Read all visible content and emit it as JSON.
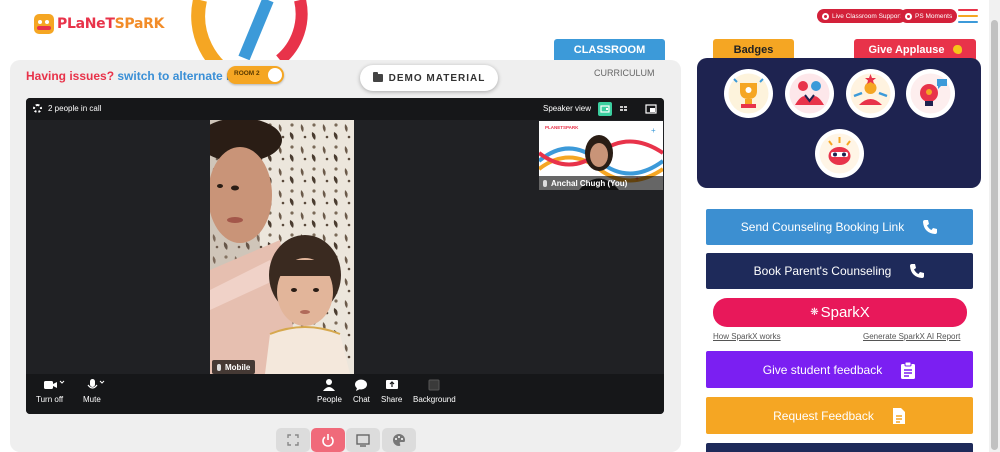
{
  "header": {
    "logo_text_a": "PLaNeT",
    "logo_text_b": "SPaRK",
    "live_support_label": "Live Classroom Support",
    "ps_moments_label": "PS Moments"
  },
  "colors": {
    "brand_red": "#e8334a",
    "brand_orange": "#f5a623",
    "blue": "#3c9ad9",
    "navy": "#1e2350",
    "purple": "#7b1ff2"
  },
  "classroom": {
    "issues_text": "Having issues?",
    "switch_text": "switch to alternate room",
    "room_toggle_label": "ROOM 2",
    "demo_material_label": "DEMO MATERIAL",
    "tab_classroom": "CLASSROOM",
    "tab_curriculum": "CURRICULUM"
  },
  "video": {
    "people_in_call": "2 people in call",
    "view_label": "Speaker view",
    "main_participant": "Mobile",
    "self_participant": "Anchal Chugh (You)",
    "controls": {
      "turn_off": "Turn off",
      "mute": "Mute",
      "people": "People",
      "chat": "Chat",
      "share": "Share",
      "background": "Background"
    }
  },
  "bottom_buttons": [
    "expand-icon",
    "power-icon",
    "screen-icon",
    "palette-icon"
  ],
  "sidebar": {
    "badges_label": "Badges",
    "applause_label": "Give Applause",
    "badges": [
      "trophy-badge",
      "team-badge",
      "star-student-badge",
      "idea-badge",
      "creative-badge"
    ],
    "send_counseling_label": "Send Counseling Booking Link",
    "book_counseling_label": "Book Parent's Counseling",
    "sparkx_label": "SparkX",
    "how_sparkx_label": "How SparkX works",
    "generate_report_label": "Generate SparkX AI Report",
    "student_feedback_label": "Give student feedback",
    "request_feedback_label": "Request Feedback"
  }
}
